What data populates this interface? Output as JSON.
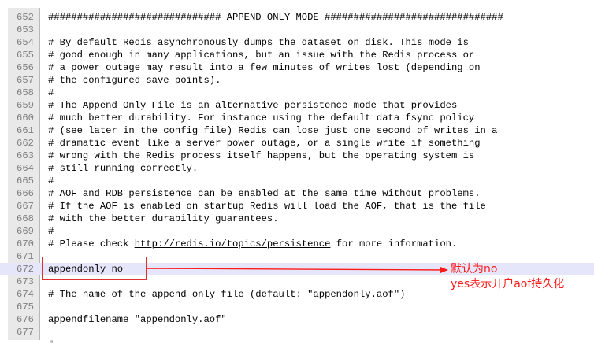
{
  "editor": {
    "lines": [
      {
        "num": "652",
        "text": "############################## APPEND ONLY MODE ###############################"
      },
      {
        "num": "653",
        "text": ""
      },
      {
        "num": "654",
        "text": "# By default Redis asynchronously dumps the dataset on disk. This mode is"
      },
      {
        "num": "655",
        "text": "# good enough in many applications, but an issue with the Redis process or"
      },
      {
        "num": "656",
        "text": "# a power outage may result into a few minutes of writes lost (depending on"
      },
      {
        "num": "657",
        "text": "# the configured save points)."
      },
      {
        "num": "658",
        "text": "#"
      },
      {
        "num": "659",
        "text": "# The Append Only File is an alternative persistence mode that provides"
      },
      {
        "num": "660",
        "text": "# much better durability. For instance using the default data fsync policy"
      },
      {
        "num": "661",
        "text": "# (see later in the config file) Redis can lose just one second of writes in a"
      },
      {
        "num": "662",
        "text": "# dramatic event like a server power outage, or a single write if something"
      },
      {
        "num": "663",
        "text": "# wrong with the Redis process itself happens, but the operating system is"
      },
      {
        "num": "664",
        "text": "# still running correctly."
      },
      {
        "num": "665",
        "text": "#"
      },
      {
        "num": "666",
        "text": "# AOF and RDB persistence can be enabled at the same time without problems."
      },
      {
        "num": "667",
        "text": "# If the AOF is enabled on startup Redis will load the AOF, that is the file"
      },
      {
        "num": "668",
        "text": "# with the better durability guarantees."
      },
      {
        "num": "669",
        "text": "#"
      },
      {
        "num": "670",
        "text": "# Please check ",
        "link": "http://redis.io/topics/persistence",
        "after": " for more information."
      },
      {
        "num": "671",
        "text": ""
      },
      {
        "num": "672",
        "text": "appendonly no",
        "highlight": true
      },
      {
        "num": "673",
        "text": ""
      },
      {
        "num": "674",
        "text": "# The name of the append only file (default: \"appendonly.aof\")"
      },
      {
        "num": "675",
        "text": ""
      },
      {
        "num": "676",
        "text": "appendfilename \"appendonly.aof\""
      },
      {
        "num": "677",
        "text": ""
      }
    ],
    "trailing_char": "\""
  },
  "annotation": {
    "line1": "默认为no",
    "line2": "yes表示开户aof持久化",
    "color": "#ff1a1a"
  }
}
